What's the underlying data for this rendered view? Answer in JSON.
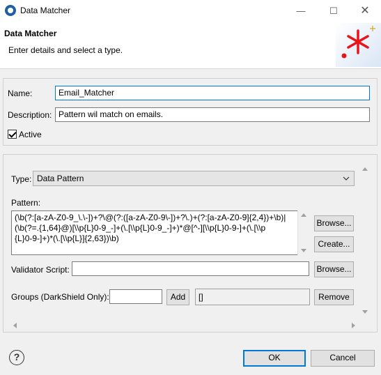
{
  "window": {
    "title": "Data Matcher",
    "icon": "app-logo-icon"
  },
  "header": {
    "title": "Data Matcher",
    "subtitle": "Enter details and select a type.",
    "logo_color": "#e8141c"
  },
  "form": {
    "name_label": "Name:",
    "name_value": "Email_Matcher",
    "description_label": "Description:",
    "description_value": "Pattern wil match on emails.",
    "active_label": "Active",
    "active_checked": true
  },
  "type": {
    "label": "Type:",
    "selected": "Data Pattern"
  },
  "pattern": {
    "label": "Pattern:",
    "lines": [
      "(\\b(?:[a-zA-Z0-9_\\.\\-])+?\\@(?:([a-zA-Z0-9\\-])+?\\.)+(?:[a-zA-Z0-9]{2,4})+\\b)|",
      "(\\b(?=.{1,64}@)[\\\\p{L}0-9_-]+(\\.[\\\\p{L}0-9_-]+)*@[^-][\\\\p{L}0-9-]+(\\.[\\\\p",
      "{L}0-9-]+)*(\\.[\\\\p{L}]{2,63})\\b)"
    ],
    "browse_label": "Browse...",
    "create_label": "Create..."
  },
  "validator": {
    "label": "Validator Script:",
    "value": "",
    "browse_label": "Browse..."
  },
  "groups": {
    "label": "Groups (DarkShield Only):",
    "input_value": "",
    "add_label": "Add",
    "list_value": "[]",
    "remove_label": "Remove"
  },
  "footer": {
    "ok_label": "OK",
    "cancel_label": "Cancel"
  },
  "colors": {
    "accent": "#0078d7"
  }
}
